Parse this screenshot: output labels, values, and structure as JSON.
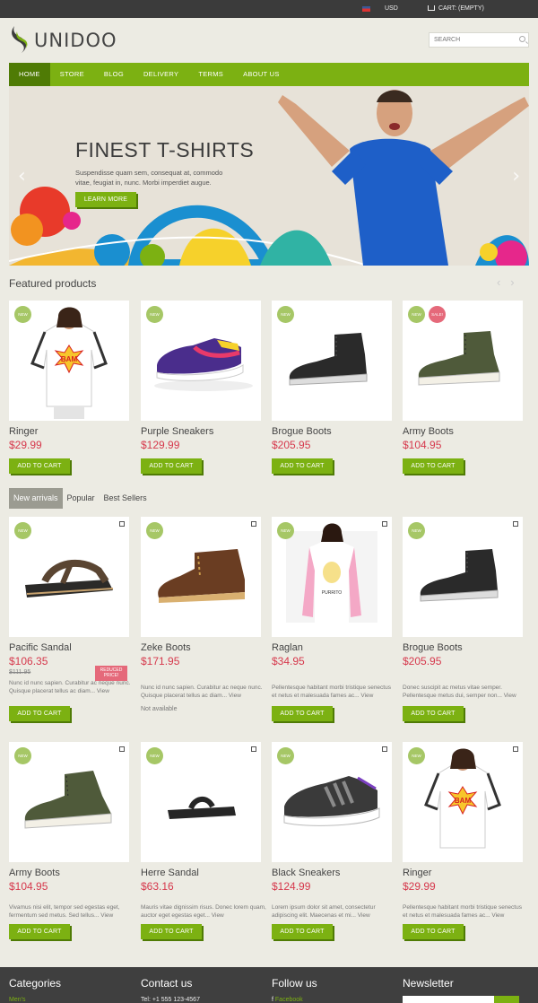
{
  "topbar": {
    "currency": "USD",
    "cart": "CART: (EMPTY)"
  },
  "brand": {
    "name": "UNIDOO",
    "accent": "#7cb112",
    "sale_color": "#d6384c"
  },
  "search": {
    "placeholder": "SEARCH"
  },
  "nav": [
    "HOME",
    "STORE",
    "BLOG",
    "DELIVERY",
    "TERMS",
    "ABOUT US"
  ],
  "slider": {
    "title": "FINEST T-SHIRTS",
    "text": "Suspendisse quam sem, consequat at, commodo vitae, feugiat in, nunc. Morbi imperdiet augue.",
    "button": "LEARN MORE"
  },
  "featured": {
    "title": "Featured products",
    "items": [
      {
        "name": "Ringer",
        "price": "$29.99",
        "badge": "NEW"
      },
      {
        "name": "Purple Sneakers",
        "price": "$129.99",
        "badge": "NEW"
      },
      {
        "name": "Brogue Boots",
        "price": "$205.95",
        "badge": "NEW"
      },
      {
        "name": "Army Boots",
        "price": "$104.95",
        "badge": "NEW",
        "badge2": "SALE!"
      }
    ]
  },
  "add_to_cart": "ADD TO CART",
  "tabs": [
    "New arrivals",
    "Popular",
    "Best Sellers"
  ],
  "grid": [
    {
      "name": "Pacific Sandal",
      "price": "$106.35",
      "old": "$111.95",
      "reduced": "REDUCED PRICE!",
      "desc": "Nunc id nunc sapien. Curabitur ac neque nunc. Quisque placerat tellus ac diam...",
      "view": "View",
      "badge": "NEW"
    },
    {
      "name": "Zeke Boots",
      "price": "$171.95",
      "desc": "Nunc id nunc sapien. Curabitur ac neque nunc. Quisque placerat tellus ac diam...",
      "view": "View",
      "na": "Not available",
      "badge": "NEW"
    },
    {
      "name": "Raglan",
      "price": "$34.95",
      "desc": "Pellentesque habitant morbi tristique senectus et netus et malesuada fames ac...",
      "view": "View",
      "badge": "NEW"
    },
    {
      "name": "Brogue Boots",
      "price": "$205.95",
      "desc": "Donec suscipit ac metus vitae semper. Pellentesque metus dui, semper non...",
      "view": "View",
      "badge": "NEW"
    },
    {
      "name": "Army Boots",
      "price": "$104.95",
      "desc": "Vivamus nisi elit, tempor sed egestas eget, fermentum sed metus. Sed tellus...",
      "view": "View",
      "badge": "NEW"
    },
    {
      "name": "Herre Sandal",
      "price": "$63.16",
      "desc": "Mauris vitae dignissim risus. Donec lorem quam, auctor eget egestas eget...",
      "view": "View",
      "badge": "NEW"
    },
    {
      "name": "Black Sneakers",
      "price": "$124.99",
      "desc": "Lorem ipsum dolor sit amet, consectetur adipiscing elit. Maecenas et mi...",
      "view": "View",
      "badge": "NEW"
    },
    {
      "name": "Ringer",
      "price": "$29.99",
      "desc": "Pellentesque habitant morbi tristique senectus et netus et malesuada fames ac...",
      "view": "View",
      "badge": "NEW"
    }
  ],
  "footer": {
    "categories": "Categories",
    "categories_first": "Men's",
    "contact": "Contact us",
    "phone": "Tel: +1 555 123-4567",
    "follow": "Follow us",
    "facebook": "Facebook",
    "newsletter": "Newsletter"
  },
  "product_image_text": {
    "tshirt_print": "BAM",
    "raglan_print": "PURRITO"
  }
}
